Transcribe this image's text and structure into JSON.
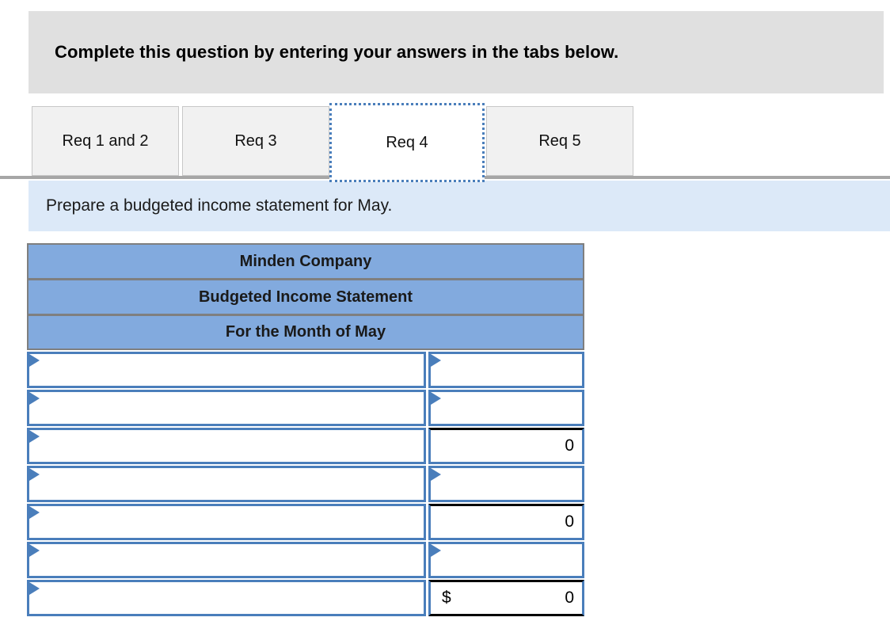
{
  "banner": {
    "text": "Complete this question by entering your answers in the tabs below."
  },
  "tabs": {
    "active_index": 2,
    "items": [
      {
        "label": "Req 1 and 2",
        "active": false
      },
      {
        "label": "Req 3",
        "active": false
      },
      {
        "label": "Req 4",
        "active": true
      },
      {
        "label": "Req 5",
        "active": false
      }
    ]
  },
  "instruction": {
    "text": "Prepare a budgeted income statement for May."
  },
  "statement": {
    "headers": [
      "Minden Company",
      "Budgeted Income Statement",
      "For the Month of May"
    ],
    "rows": [
      {
        "description": "",
        "currency": "",
        "value": "",
        "rule_top": false,
        "rule_bottom": false,
        "value_has_combo": true
      },
      {
        "description": "",
        "currency": "",
        "value": "",
        "rule_top": false,
        "rule_bottom": false,
        "value_has_combo": true
      },
      {
        "description": "",
        "currency": "",
        "value": "0",
        "rule_top": true,
        "rule_bottom": false,
        "value_has_combo": false
      },
      {
        "description": "",
        "currency": "",
        "value": "",
        "rule_top": false,
        "rule_bottom": false,
        "value_has_combo": true
      },
      {
        "description": "",
        "currency": "",
        "value": "0",
        "rule_top": true,
        "rule_bottom": false,
        "value_has_combo": false
      },
      {
        "description": "",
        "currency": "",
        "value": "",
        "rule_top": false,
        "rule_bottom": false,
        "value_has_combo": true
      },
      {
        "description": "",
        "currency": "$",
        "value": "0",
        "rule_top": true,
        "rule_bottom": true,
        "value_has_combo": false
      }
    ]
  },
  "colors": {
    "banner_background": "#e0e0e0",
    "instruction_background": "#dce9f8",
    "table_header_blue": "#82aade",
    "table_header_border": "#7f7f7f",
    "cell_border_blue": "#4a7ebb",
    "active_tab_border": "#4a7ebb",
    "tab_background": "#f1f1f1",
    "rule_black": "#000000"
  },
  "icons": {
    "combo_arrow": "dropdown-triangle-icon"
  }
}
